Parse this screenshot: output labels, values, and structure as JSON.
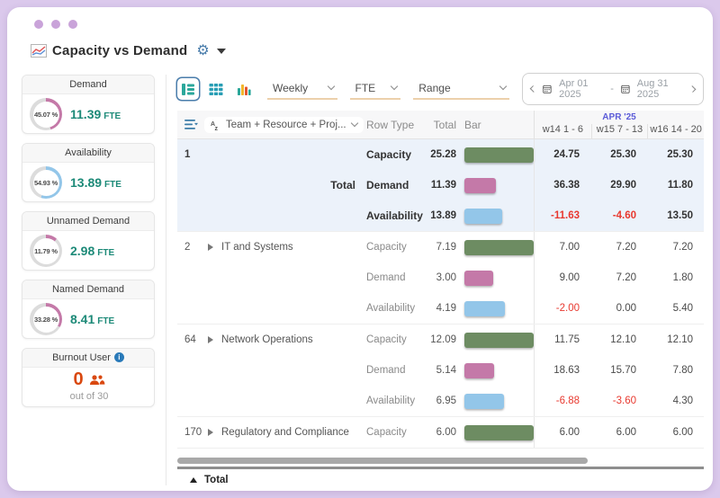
{
  "colors": {
    "capacity": "#6d8c62",
    "demand": "#c479a8",
    "availability": "#93c6e9",
    "negative": "#e8392f",
    "ring_track": "#dcdcdc",
    "fte_teal": "#1d8a78",
    "burnout_orange": "#d9480f",
    "month_label": "#5b5bd8",
    "selected_view_border": "#4a7dab",
    "highlight_row_bg": "#ecf2fa",
    "dropdown_underline": "#ecd0ab"
  },
  "window": {
    "title": "Capacity vs Demand"
  },
  "sidebar": {
    "cards": [
      {
        "title": "Demand",
        "percent": "45.07 %",
        "pct": 45.07,
        "value": "11.39",
        "unit": "FTE",
        "ring": "#c479a8"
      },
      {
        "title": "Availability",
        "percent": "54.93 %",
        "pct": 54.93,
        "value": "13.89",
        "unit": "FTE",
        "ring": "#93c6e9"
      },
      {
        "title": "Unnamed Demand",
        "percent": "11.79 %",
        "pct": 11.79,
        "value": "2.98",
        "unit": "FTE",
        "ring": "#c479a8"
      },
      {
        "title": "Named Demand",
        "percent": "33.28 %",
        "pct": 33.28,
        "value": "8.41",
        "unit": "FTE",
        "ring": "#c479a8"
      }
    ],
    "burnout": {
      "title": "Burnout User",
      "count": "0",
      "caption": "out of 30"
    }
  },
  "toolbar": {
    "dropdowns": [
      {
        "label": "Weekly"
      },
      {
        "label": "FTE"
      },
      {
        "label": "Range"
      }
    ],
    "date_range": {
      "start": "Apr 01 2025",
      "separator": "-",
      "end": "Aug 31 2025"
    }
  },
  "table": {
    "grouping_dropdown": "Team + Resource + Proj...",
    "headers": {
      "row_type": "Row Type",
      "total": "Total",
      "bar": "Bar"
    },
    "month_label": "APR '25",
    "weeks": [
      "w14 1 - 6",
      "w15 7 - 13",
      "w16 14 - 20"
    ],
    "groups": [
      {
        "id": "1",
        "name": "Total",
        "expandable": false,
        "highlight": true,
        "rows": [
          {
            "type": "Capacity",
            "total": "25.28",
            "weeks": [
              "24.75",
              "25.30",
              "25.30"
            ]
          },
          {
            "type": "Demand",
            "total": "11.39",
            "weeks": [
              "36.38",
              "29.90",
              "11.80"
            ]
          },
          {
            "type": "Availability",
            "total": "13.89",
            "weeks": [
              "-11.63",
              "-4.60",
              "13.50"
            ]
          }
        ]
      },
      {
        "id": "2",
        "name": "IT and Systems",
        "expandable": true,
        "highlight": false,
        "rows": [
          {
            "type": "Capacity",
            "total": "7.19",
            "weeks": [
              "7.00",
              "7.20",
              "7.20"
            ]
          },
          {
            "type": "Demand",
            "total": "3.00",
            "weeks": [
              "9.00",
              "7.20",
              "1.80"
            ]
          },
          {
            "type": "Availability",
            "total": "4.19",
            "weeks": [
              "-2.00",
              "0.00",
              "5.40"
            ]
          }
        ]
      },
      {
        "id": "64",
        "name": "Network Operations",
        "expandable": true,
        "highlight": false,
        "rows": [
          {
            "type": "Capacity",
            "total": "12.09",
            "weeks": [
              "11.75",
              "12.10",
              "12.10"
            ]
          },
          {
            "type": "Demand",
            "total": "5.14",
            "weeks": [
              "18.63",
              "15.70",
              "7.80"
            ]
          },
          {
            "type": "Availability",
            "total": "6.95",
            "weeks": [
              "-6.88",
              "-3.60",
              "4.30"
            ]
          }
        ]
      },
      {
        "id": "170",
        "name": "Regulatory and Compliance",
        "expandable": true,
        "highlight": false,
        "rows": [
          {
            "type": "Capacity",
            "total": "6.00",
            "weeks": [
              "6.00",
              "6.00",
              "6.00"
            ]
          }
        ]
      }
    ]
  },
  "footer": {
    "label": "Total"
  }
}
